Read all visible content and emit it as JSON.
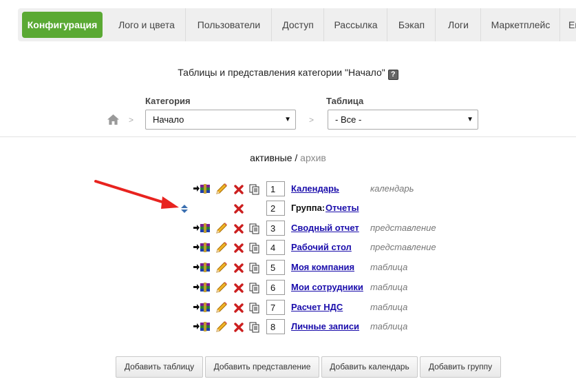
{
  "tabs": [
    {
      "label": "Конфигурация",
      "active": true
    },
    {
      "label": "Лого и цвета"
    },
    {
      "label": "Пользователи"
    },
    {
      "label": "Доступ"
    },
    {
      "label": "Рассылка"
    },
    {
      "label": "Бэкап"
    },
    {
      "label": "Логи"
    },
    {
      "label": "Маркетплейс"
    },
    {
      "label": "En"
    }
  ],
  "page": {
    "title": "Таблицы и представления категории \"Начало\"",
    "help": "?"
  },
  "breadcrumb": {
    "separator": ">"
  },
  "filters": {
    "category_label": "Категория",
    "category_value": "Начало",
    "table_label": "Таблица",
    "table_value": "- Все -"
  },
  "status": {
    "active": "активные",
    "separator": "/",
    "archive": "архив"
  },
  "rows": [
    {
      "order": "1",
      "name": "Календарь",
      "type": "календарь"
    },
    {
      "order": "2",
      "group_prefix": "Группа:",
      "name": "Отчеты",
      "type": ""
    },
    {
      "order": "3",
      "name": "Сводный отчет",
      "type": "представление"
    },
    {
      "order": "4",
      "name": "Рабочий стол",
      "type": "представление"
    },
    {
      "order": "5",
      "name": "Моя компания",
      "type": "таблица"
    },
    {
      "order": "6",
      "name": "Мои сотрудники",
      "type": "таблица"
    },
    {
      "order": "7",
      "name": "Расчет НДС",
      "type": "таблица"
    },
    {
      "order": "8",
      "name": "Личные записи",
      "type": "таблица"
    }
  ],
  "buttons": {
    "add_table": "Добавить таблицу",
    "add_view": "Добавить представление",
    "add_calendar": "Добавить календарь",
    "add_group": "Добавить группу"
  },
  "colors": {
    "accent": "#5aa933",
    "link": "#1a0dab",
    "delete": "#cc1f1f",
    "annotation_arrow": "#e8231f"
  }
}
